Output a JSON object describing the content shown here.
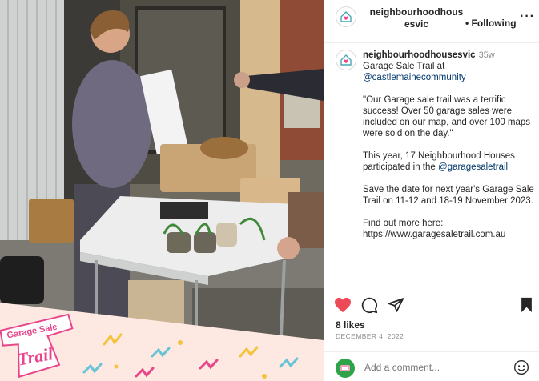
{
  "post": {
    "username": "neighbourhoodhousesvic",
    "header_name_line1": "neighbourhoodhous",
    "header_name_line2": "esvic",
    "following_label": "• Following",
    "more_label": "···",
    "time_ago": "35w",
    "caption_line1": "Garage Sale Trail at",
    "mention_castlemaine": "@castlemainecommunity",
    "para1": "\"Our Garage sale trail was a terrific success! Over 50 garage sales were included on our map, and over 100 maps were sold on the day.\"",
    "para2_before": "This year, 17 Neighbourhood Houses participated in the",
    "mention_gst": "@garagesaletrail",
    "para3": "Save the date for next year's Garage Sale Trail on 11-12 and 18-19 November 2023.",
    "para4_line1": "Find out more here:",
    "para4_link": "https://www.garagesaletrail.com.au",
    "likes": "8 likes",
    "date": "DECEMBER 4, 2022",
    "comment_placeholder": "Add a comment..."
  },
  "photo": {
    "logo_line1": "Garage Sale",
    "logo_line2": "Trail"
  },
  "icons": {
    "like": "heart-icon",
    "comment": "comment-icon",
    "share": "share-icon",
    "save": "bookmark-icon",
    "emoji": "emoji-icon",
    "more": "more-icon"
  },
  "colors": {
    "like_red": "#ed4956",
    "mention_blue": "#00376b",
    "logo_pink": "#e8458b",
    "banner_bg": "#fde9e1"
  }
}
